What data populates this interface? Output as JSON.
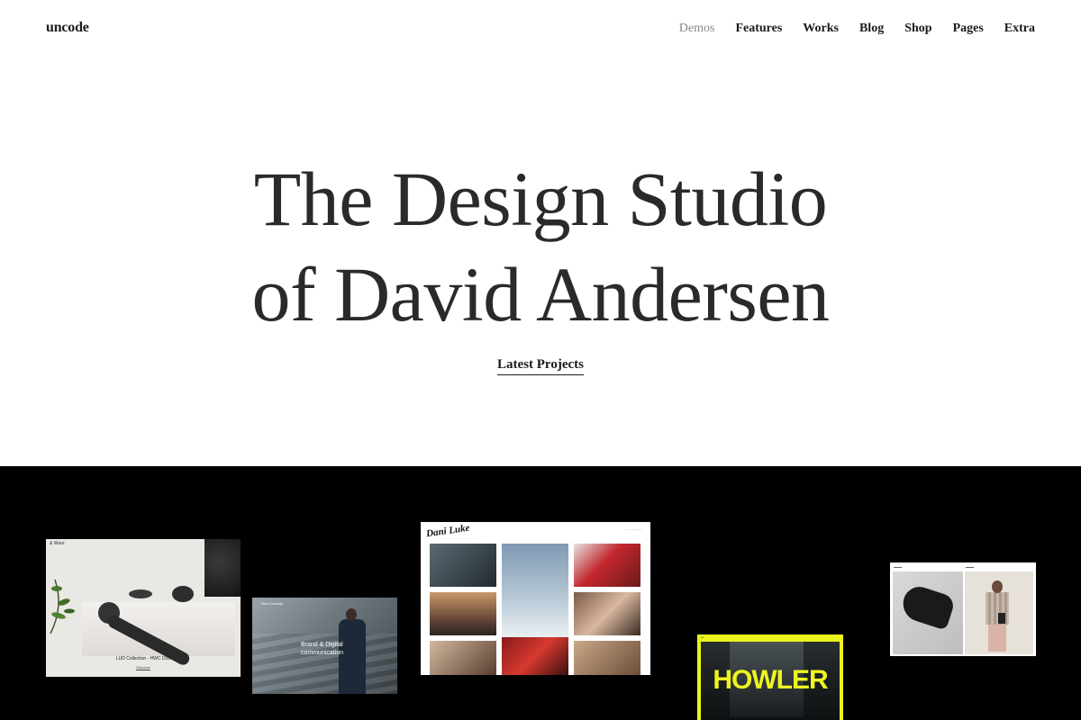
{
  "header": {
    "logo": "uncode",
    "nav": [
      {
        "label": "Demos",
        "active": true
      },
      {
        "label": "Features",
        "active": false
      },
      {
        "label": "Works",
        "active": false
      },
      {
        "label": "Blog",
        "active": false
      },
      {
        "label": "Shop",
        "active": false
      },
      {
        "label": "Pages",
        "active": false
      },
      {
        "label": "Extra",
        "active": false
      }
    ]
  },
  "hero": {
    "title_line1": "The Design Studio",
    "title_line2": "of David Andersen",
    "cta": "Latest Projects"
  },
  "showcase": {
    "card1": {
      "brand": "& Ware",
      "caption": "LUD Collection - HWC D03",
      "subcaption": "Discover"
    },
    "card2": {
      "top_label": "Next Concept",
      "text_line1": "Brand & Digital",
      "text_line2": "communication"
    },
    "card3": {
      "logo": "Dani Luke"
    },
    "card4": {
      "word": "HOWLER"
    }
  },
  "colors": {
    "background": "#ffffff",
    "text": "#2a2a2a",
    "nav_active": "#888888",
    "showcase_bg": "#000000",
    "howler_yellow": "#e9f51a"
  }
}
